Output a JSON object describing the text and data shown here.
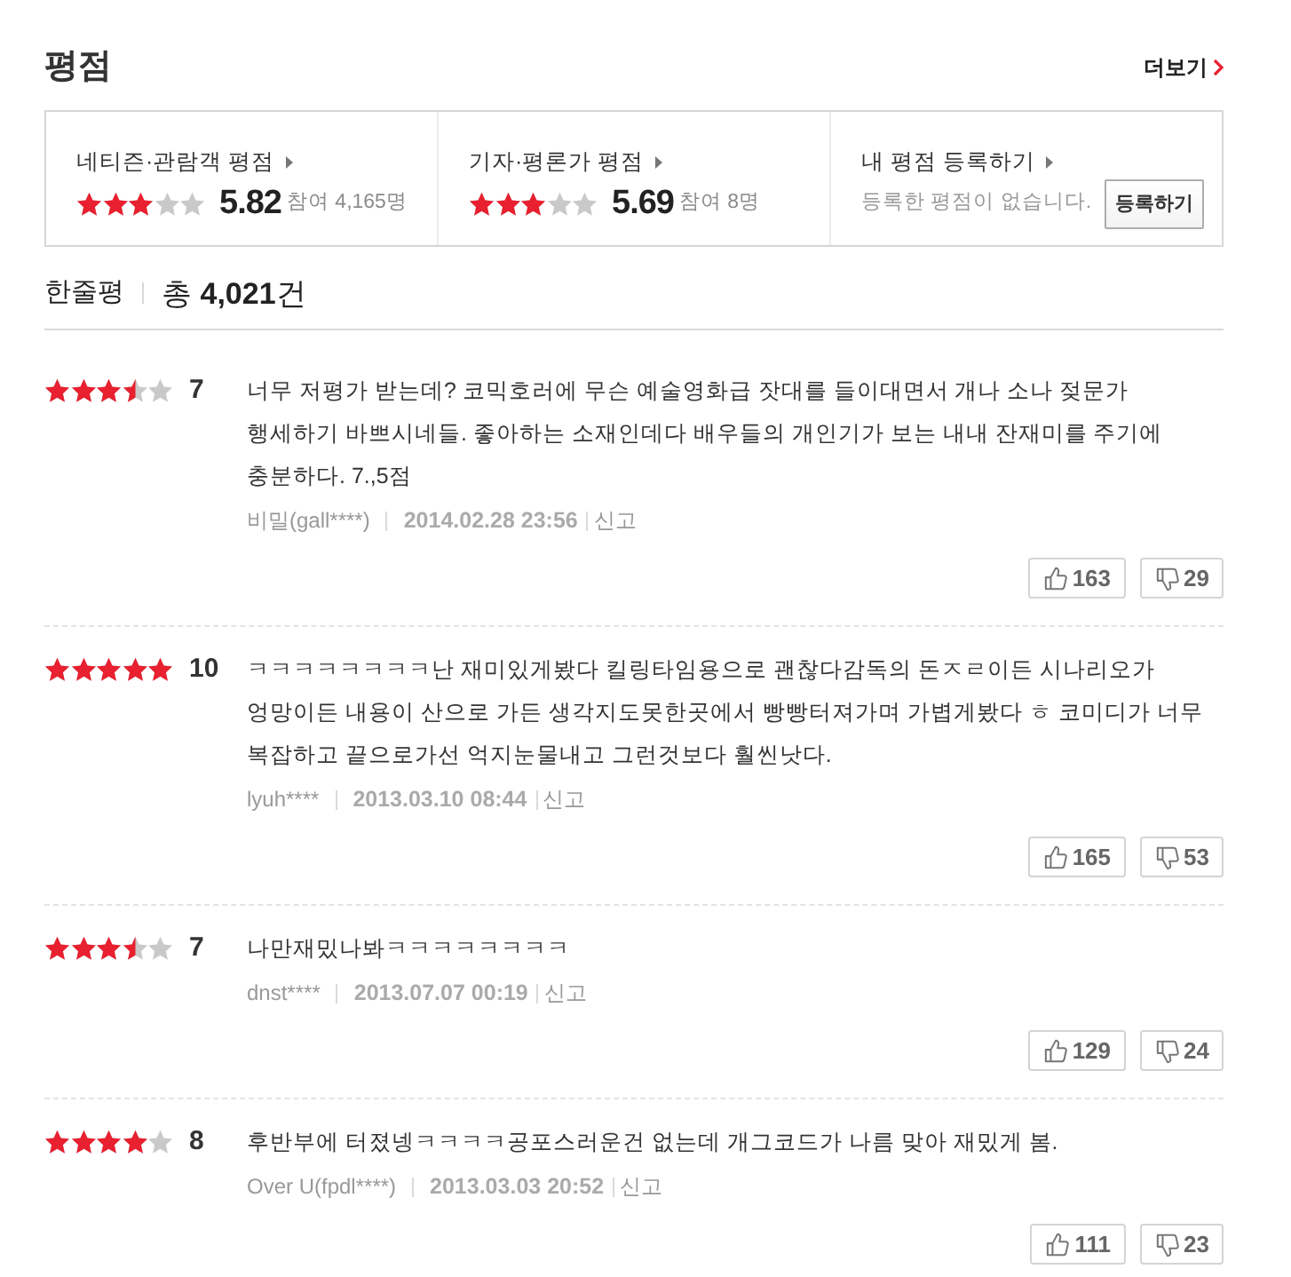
{
  "header": {
    "title": "평점",
    "more_link": "더보기"
  },
  "score_panels": [
    {
      "kind": "score",
      "label": "네티즌·관람객 평점",
      "stars": 3,
      "score": "5.82",
      "participants": "참여 4,165명"
    },
    {
      "kind": "score",
      "label": "기자·평론가 평점",
      "stars": 3,
      "score": "5.69",
      "participants": "참여 8명"
    },
    {
      "kind": "register",
      "label": "내 평점 등록하기",
      "message": "등록한 평점이 없습니다.",
      "button": "등록하기"
    }
  ],
  "reviews_summary": {
    "title": "한줄평",
    "total": "총 **4,021**건"
  },
  "reviews": [
    {
      "stars": 3.5,
      "score": "7",
      "text": "너무 저평가 받는데? 코믹호러에 무슨 예술영화급 잣대를 들이대면서 개나 소나 젖문가 행세하기 바쁘시네들. 좋아하는 소재인데다 배우들의 개인기가 보는 내내 잔재미를 주기에 충분하다. 7.,5점",
      "author": "비밀(gall****)",
      "date": "2014.02.28 23:56",
      "report": "신고",
      "likes": "163",
      "dislikes": "29"
    },
    {
      "stars": 5,
      "score": "10",
      "text": "ㅋㅋㅋㅋㅋㅋㅋㅋ난 재미있게봤다 킬링타임용으로 괜찮다감독의 돈ㅈㄹ이든 시나리오가 엉망이든 내용이 산으로 가든 생각지도못한곳에서 빵빵터져가며 가볍게봤다 ㅎ 코미디가 너무 복잡하고 끝으로가선 억지눈물내고 그런것보다 훨씬낫다.",
      "author": "lyuh****",
      "date": "2013.03.10 08:44",
      "report": "신고",
      "likes": "165",
      "dislikes": "53"
    },
    {
      "stars": 3.5,
      "score": "7",
      "text": "나만재밌나봐ㅋㅋㅋㅋㅋㅋㅋㅋ",
      "author": "dnst****",
      "date": "2013.07.07 00:19",
      "report": "신고",
      "likes": "129",
      "dislikes": "24"
    },
    {
      "stars": 4,
      "score": "8",
      "text": "후반부에 터졌넹ㅋㅋㅋㅋ공포스러운건 없는데 개그코드가 나름 맞아 재밌게 봄.",
      "author": "Over U(fpdl****)",
      "date": "2013.03.03 20:52",
      "report": "신고",
      "likes": "111",
      "dislikes": "23"
    }
  ]
}
